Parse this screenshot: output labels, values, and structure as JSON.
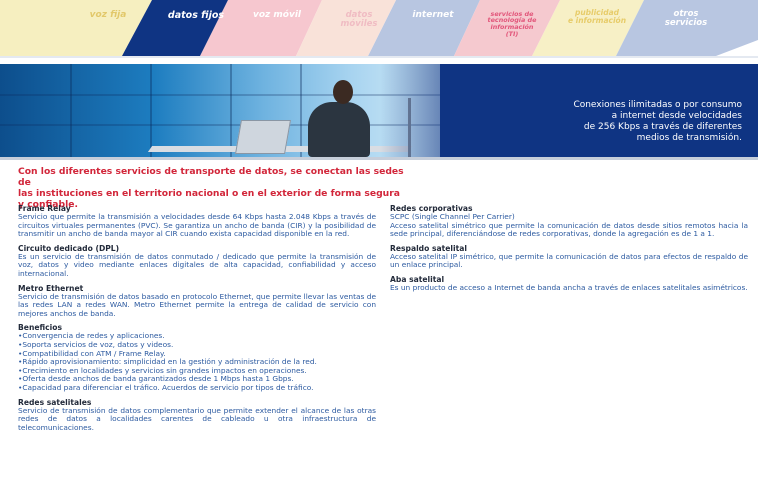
{
  "nav": {
    "tabs": [
      {
        "label": "voz  fija",
        "color": "#f6efc0",
        "text_color": "#e2c86a"
      },
      {
        "label": "datos  fijos",
        "color": "#0f3483",
        "text_color": "#ffffff"
      },
      {
        "label": "voz móvil",
        "color": "#f6c7cf",
        "text_color": "#ffffff"
      },
      {
        "label": "datos\nmóviles",
        "color": "#f9e2d9",
        "text_color": "#f0bcc3"
      },
      {
        "label": "internet",
        "color": "#b8c6e1",
        "text_color": "#ffffff"
      },
      {
        "label": "servicios de\ntecnología de\ninformación\n(TI)",
        "color": "#f5c9cf",
        "text_color": "#e2557a"
      },
      {
        "label": "publicidad\ne información",
        "color": "#f7f0c6",
        "text_color": "#e7cc6a"
      },
      {
        "label": "otros\nservicios",
        "color": "#b8c6e1",
        "text_color": "#ffffff"
      }
    ]
  },
  "banner": {
    "text": "Conexiones ilimitadas o por consumo\na internet desde velocidades\nde 256 Kbps a través de diferentes\nmedios de transmisión."
  },
  "intro": "Con los diferentes servicios de transporte de datos, se conectan las sedes de\nlas instituciones en el territorio nacional o en el exterior de forma segura y confiable.",
  "left": {
    "frame_relay": {
      "title": "Frame Relay",
      "text": "Servicio que permite la transmisión a velocidades desde 64 Kbps hasta 2.048 Kbps a través de circuitos virtuales permanentes (PVC). Se garantiza un ancho de banda (CIR) y la posibilidad de transmitir un ancho de banda mayor al CIR cuando exista capacidad disponible en la red."
    },
    "dpl": {
      "title": "Circuito dedicado (DPL)",
      "text": "Es un servicio de transmisión de datos conmutado / dedicado que permite la transmisión de voz, datos y video mediante enlaces digitales de alta capacidad, confiabilidad y acceso internacional."
    },
    "metro": {
      "title": "Metro Ethernet",
      "text": "Servicio de transmisión de datos basado en protocolo Ethernet, que permite llevar las ventas de las redes LAN a redes WAN. Metro Ethernet  permite la entrega de calidad de servicio con mejores anchos de banda."
    },
    "beneficios": {
      "title": "Beneficios",
      "items": [
        "•Convergencia de redes y aplicaciones.",
        "•Soporta servicios de voz, datos y videos.",
        "•Compatibilidad con ATM / Frame Relay.",
        "•Rápido aprovisionamiento: simplicidad en la gestión y administración de la red.",
        "•Crecimiento en localidades y servicios sin grandes impactos en operaciones.",
        "•Oferta desde anchos de banda garantizados desde 1 Mbps hasta 1 Gbps.",
        "•Capacidad para diferenciar el tráfico. Acuerdos de servicio por tipos de tráfico."
      ]
    },
    "satelitales": {
      "title": "Redes satelitales",
      "text": "Servicio de transmisión de datos complementario que permite extender el alcance de las otras redes de datos a localidades carentes de cableado u otra infraestructura de telecomunicaciones."
    }
  },
  "right": {
    "corporativas": {
      "title": "Redes corporativas",
      "text": "SCPC (Single Channel Per Carrier)\nAcceso satelital simétrico que permite la comunicación de datos desde sitios remotos hacia la sede principal, diferenciándose de redes corporativas, donde la agregación es de 1 a 1."
    },
    "respaldo": {
      "title": "Respaldo satelital",
      "text": "Acceso satelital IP simétrico, que permite la comunicación de datos para efectos de respaldo de un enlace principal."
    },
    "aba": {
      "title": "Aba satelital",
      "text": "Es un producto de acceso a Internet de banda ancha a través de enlaces satelitales asimétricos."
    }
  }
}
